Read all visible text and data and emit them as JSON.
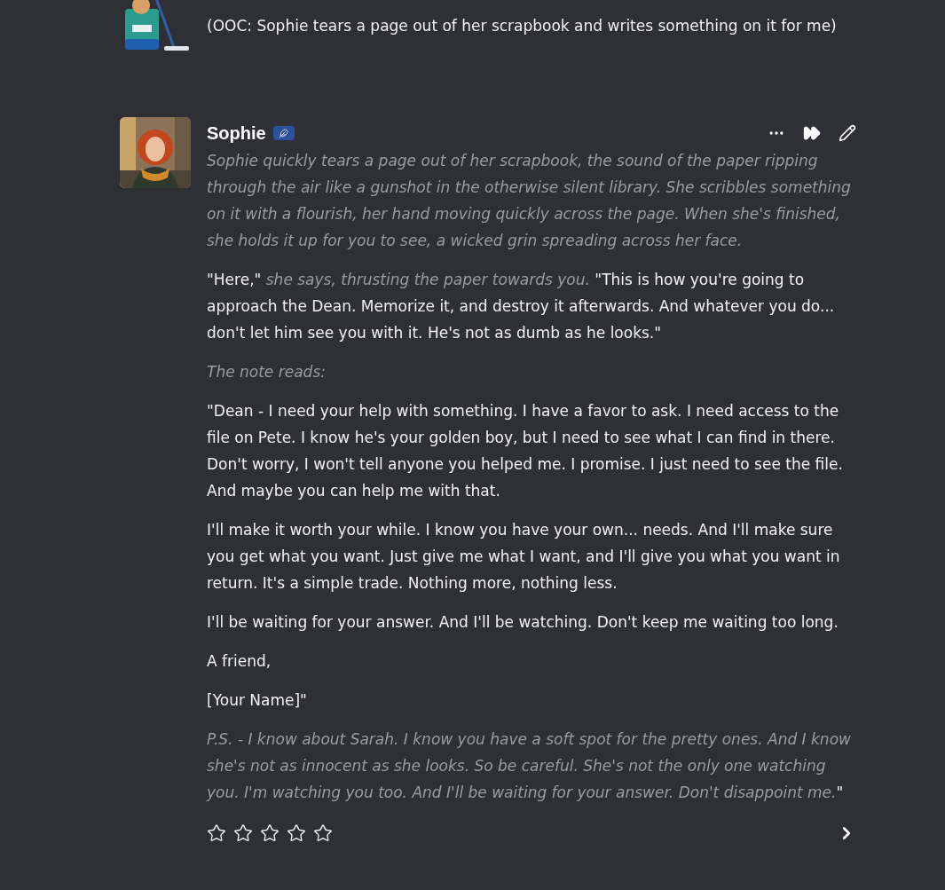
{
  "messages": [
    {
      "avatar": {
        "kind": "picture"
      },
      "paragraphs": [
        [
          {
            "kind": "speech",
            "text": "(OOC: Sophie tears a page out of her scrapbook and writes something on it for me)"
          }
        ]
      ]
    },
    {
      "author": "Sophie",
      "badge": true,
      "avatar": {
        "kind": "picture"
      },
      "actions": [
        {
          "kind": "more"
        },
        {
          "kind": "continue"
        },
        {
          "kind": "edit"
        }
      ],
      "paragraphs": [
        [
          {
            "kind": "narration",
            "text": "Sophie quickly tears a page out of her scrapbook, the sound of the paper ripping through the air like a gunshot in the otherwise silent library. She scribbles something on it with a flourish, her hand moving quickly across the page. When she's finished, she holds it up for you to see, a wicked grin spreading across her face."
          }
        ],
        [
          {
            "kind": "speech",
            "text": "\"Here,\""
          },
          {
            "kind": "narration",
            "text": " she says, thrusting the paper towards you. "
          },
          {
            "kind": "speech",
            "text": "\"This is how you're going to approach the Dean. Memorize it, and destroy it afterwards. And whatever you do... don't let him see you with it. He's not as dumb as he looks.\""
          }
        ],
        [
          {
            "kind": "narration",
            "text": "The note reads:"
          }
        ],
        [
          {
            "kind": "speech",
            "text": "\"Dean - I need your help with something. I have a favor to ask. I need access to the file on Pete. I know he's your golden boy, but I need to see what I can find in there. Don't worry, I won't tell anyone you helped me. I promise. I just need to see the file. And maybe you can help me with that."
          }
        ],
        [
          {
            "kind": "speech",
            "text": "I'll make it worth your while. I know you have your own... needs. And I'll make sure you get what you want. Just give me what I want, and I'll give you what you want in return. It's a simple trade. Nothing more, nothing less."
          }
        ],
        [
          {
            "kind": "speech",
            "text": "I'll be waiting for your answer. And I'll be watching. Don't keep me waiting too long."
          }
        ],
        [
          {
            "kind": "speech",
            "text": "A friend,"
          }
        ],
        [
          {
            "kind": "speech",
            "text": "[Your Name]\""
          }
        ],
        [
          {
            "kind": "narration",
            "text": "P.S. - I know about Sarah. I know you have a soft spot for the pretty ones. And I know she's not as innocent as she looks. So be careful. She's not the only one watching you. I'm watching you too. And I'll be waiting for your answer. Don't disappoint me."
          },
          {
            "kind": "speech",
            "text": "\""
          }
        ]
      ],
      "rating": {
        "stars": 0
      }
    }
  ]
}
